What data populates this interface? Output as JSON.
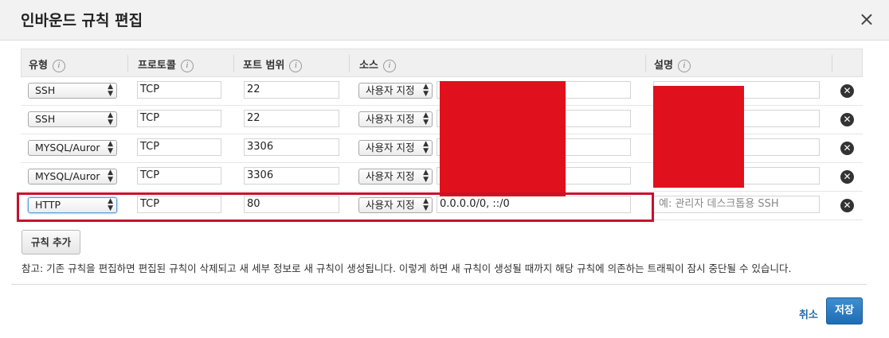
{
  "dialog": {
    "title": "인바운드 규칙 편집",
    "close_icon": "×"
  },
  "columns": {
    "type": "유형",
    "protocol": "프로토콜",
    "port_range": "포트 범위",
    "source": "소스",
    "description": "설명",
    "info_glyph": "i"
  },
  "rows": [
    {
      "type": "SSH",
      "protocol": "TCP",
      "port": "22",
      "source_mode": "사용자 지정",
      "source_value": "",
      "description": ""
    },
    {
      "type": "SSH",
      "protocol": "TCP",
      "port": "22",
      "source_mode": "사용자 지정",
      "source_value": "",
      "description": ""
    },
    {
      "type": "MYSQL/Auror",
      "protocol": "TCP",
      "port": "3306",
      "source_mode": "사용자 지정",
      "source_value": "",
      "description": ""
    },
    {
      "type": "MYSQL/Auror",
      "protocol": "TCP",
      "port": "3306",
      "source_mode": "사용자 지정",
      "source_value": "",
      "description": ""
    },
    {
      "type": "HTTP",
      "protocol": "TCP",
      "port": "80",
      "source_mode": "사용자 지정",
      "source_value": "0.0.0.0/0, ::/0",
      "description_placeholder": "예: 관리자 데스크톱용 SSH"
    }
  ],
  "delete_icon": "✕",
  "add_rule_label": "규칙 추가",
  "note": "참고: 기존 규칙을 편집하면 편집된 규칙이 삭제되고 새 세부 정보로 새 규칙이 생성됩니다. 이렇게 하면 새 규칙이 생성될 때까지 해당 규칙에 의존하는 트래픽이 잠시 중단될 수 있습니다.",
  "footer": {
    "cancel_label": "취소",
    "save_label": "저장"
  },
  "colors": {
    "highlight": "#c8102e",
    "redaction": "#e0101c",
    "primary_button": "#1f6db5",
    "link": "#1a6eb0"
  }
}
